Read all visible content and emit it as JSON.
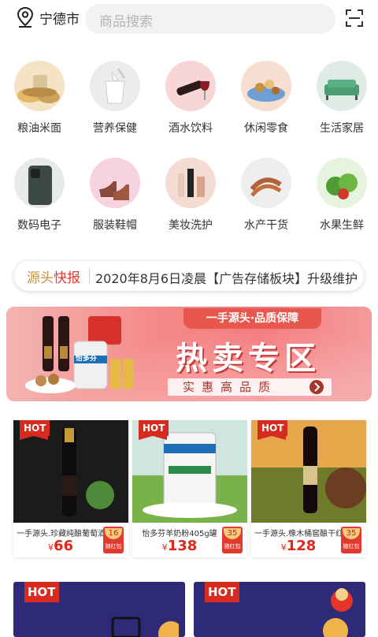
{
  "header": {
    "city": "宁德市",
    "search_placeholder": "商品搜索"
  },
  "categories": [
    {
      "label": "粮油米面",
      "icon": "grain-icon"
    },
    {
      "label": "营养保健",
      "icon": "supplement-icon"
    },
    {
      "label": "酒水饮料",
      "icon": "wine-icon"
    },
    {
      "label": "休闲零食",
      "icon": "snack-icon"
    },
    {
      "label": "生活家居",
      "icon": "sofa-icon"
    },
    {
      "label": "数码电子",
      "icon": "phone-icon"
    },
    {
      "label": "服装鞋帽",
      "icon": "shoe-icon"
    },
    {
      "label": "美妆洗护",
      "icon": "cosmetics-icon"
    },
    {
      "label": "水产干货",
      "icon": "shrimp-icon"
    },
    {
      "label": "水果生鲜",
      "icon": "vegetable-icon"
    }
  ],
  "news": {
    "tag_prefix": "源头",
    "tag_suffix": "快报",
    "text": "2020年8月6日凌晨【广告存储板块】升级维护"
  },
  "banner": {
    "ribbon": "一手源头·品质保障",
    "title": "热卖专区",
    "slogan": "实惠高品质",
    "product_label": "怡多芬"
  },
  "products": [
    {
      "hot": "HOT",
      "name": "一手源头.珍藏纯酿葡萄酒",
      "currency": "¥",
      "price": "66",
      "redpack_amount": "16",
      "redpack_text": "随红包"
    },
    {
      "hot": "HOT",
      "name": "怡多芬羊奶粉405g罐",
      "currency": "¥",
      "price": "138",
      "redpack_amount": "35",
      "redpack_text": "随红包"
    },
    {
      "hot": "HOT",
      "name": "一手源头.橡木桶窖酿干红葡萄酒",
      "currency": "¥",
      "price": "128",
      "redpack_amount": "35",
      "redpack_text": "随红包"
    }
  ],
  "bottom_cards": [
    {
      "hot": "HOT"
    },
    {
      "hot": "HOT"
    }
  ],
  "colors": {
    "accent_red": "#e0271a",
    "hot_badge": "#d62b1f",
    "banner_pink": "#f48a89",
    "gold": "#c8913c"
  }
}
